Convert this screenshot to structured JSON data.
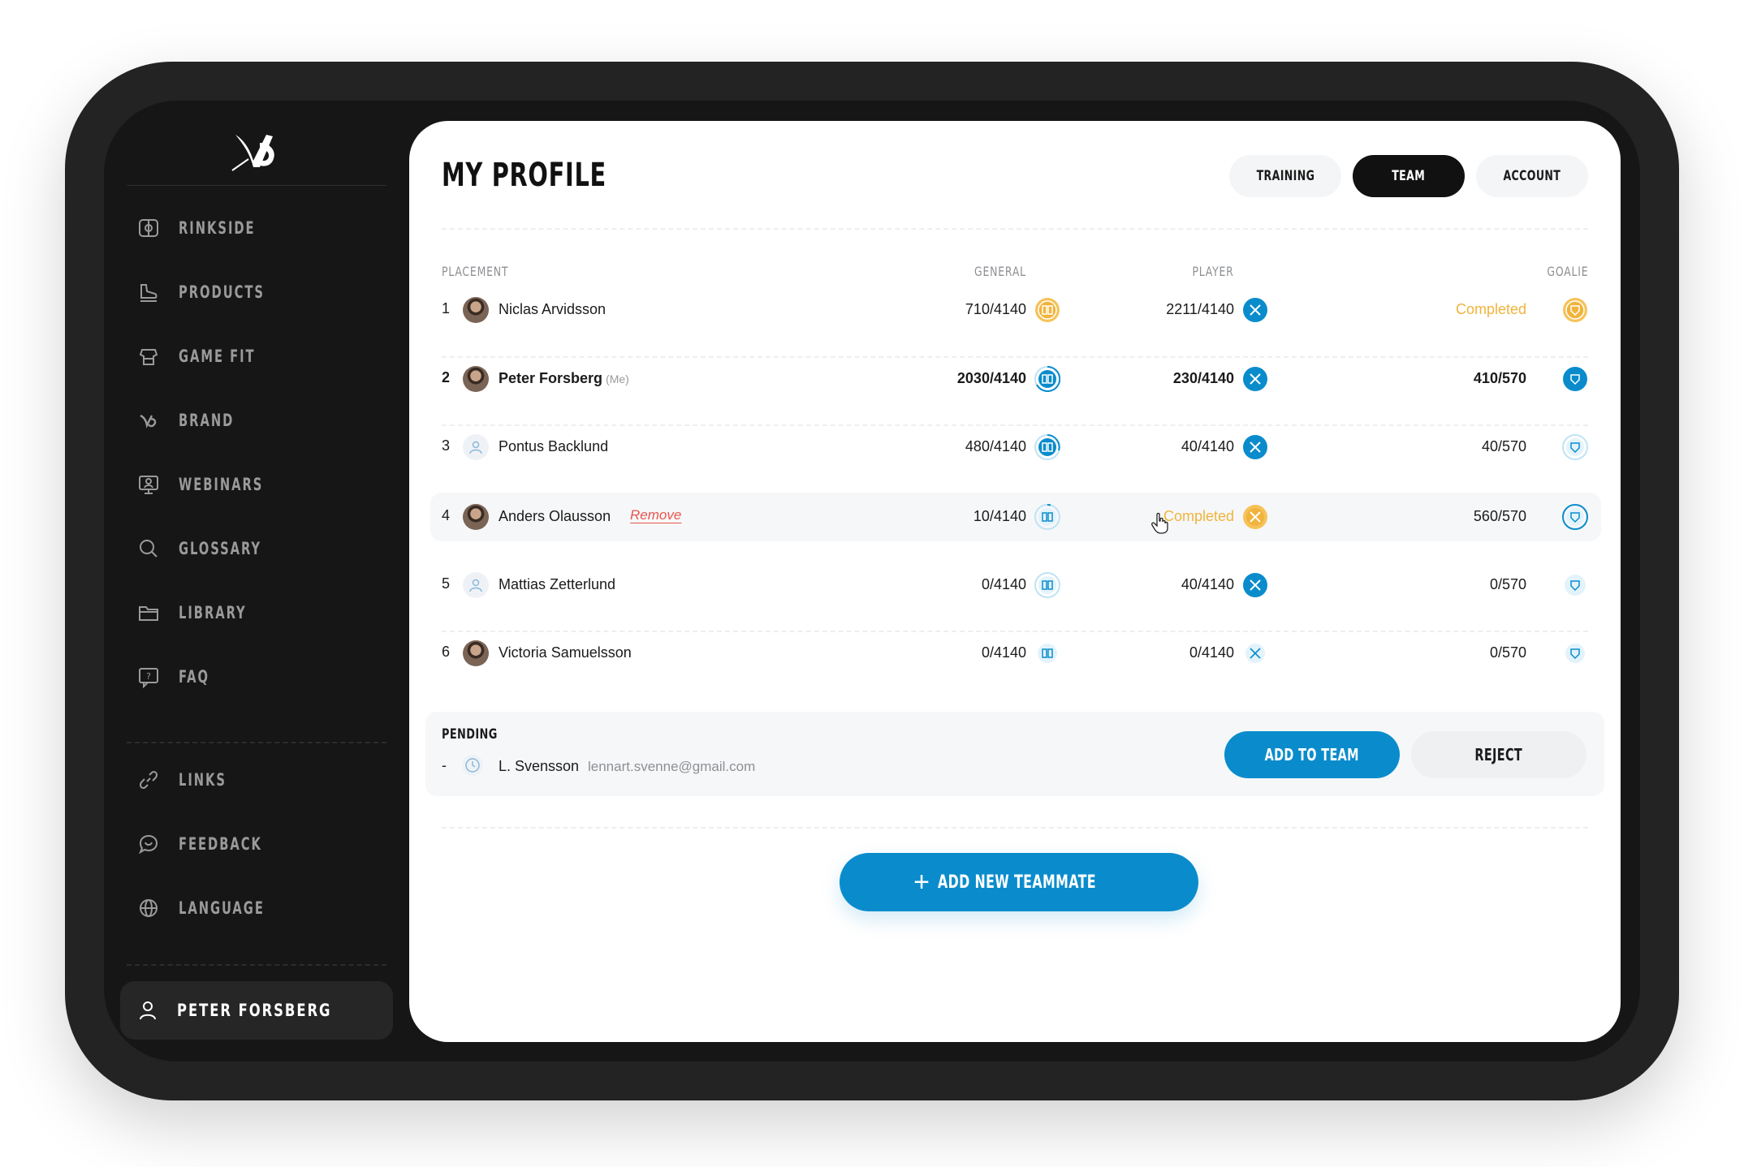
{
  "colors": {
    "accent_blue": "#0a8ccc",
    "gold": "#f0b43c",
    "danger": "#e8564d",
    "sidebar_bg": "#161616"
  },
  "sidebar": {
    "logo_icon": "brand-logo-icon",
    "items": [
      {
        "label": "RINKSIDE",
        "icon": "rink-icon"
      },
      {
        "label": "PRODUCTS",
        "icon": "skate-icon"
      },
      {
        "label": "GAME FIT",
        "icon": "fit-icon"
      },
      {
        "label": "BRAND",
        "icon": "brand-icon"
      },
      {
        "label": "WEBINARS",
        "icon": "webinar-icon"
      },
      {
        "label": "GLOSSARY",
        "icon": "search-icon"
      },
      {
        "label": "LIBRARY",
        "icon": "folder-icon"
      },
      {
        "label": "FAQ",
        "icon": "question-icon"
      }
    ],
    "secondary": [
      {
        "label": "LINKS",
        "icon": "link-icon"
      },
      {
        "label": "FEEDBACK",
        "icon": "chat-icon"
      },
      {
        "label": "LANGUAGE",
        "icon": "globe-icon"
      }
    ],
    "user": "PETER FORSBERG"
  },
  "header": {
    "title": "MY PROFILE",
    "tabs": [
      {
        "label": "TRAINING",
        "active": false
      },
      {
        "label": "TEAM",
        "active": true
      },
      {
        "label": "ACCOUNT",
        "active": false
      }
    ]
  },
  "table": {
    "columns": {
      "placement": "PLACEMENT",
      "general": "GENERAL",
      "player": "PLAYER",
      "goalie": "GOALIE"
    },
    "rows": [
      {
        "rank": "1",
        "name": "Niclas Arvidsson",
        "me": "",
        "general": "710/4140",
        "player": "2211/4140",
        "goalie": "Completed"
      },
      {
        "rank": "2",
        "name": "Peter Forsberg",
        "me": "(Me)",
        "general": "2030/4140",
        "player": "230/4140",
        "goalie": "410/570"
      },
      {
        "rank": "3",
        "name": "Pontus Backlund",
        "me": "",
        "general": "480/4140",
        "player": "40/4140",
        "goalie": "40/570"
      },
      {
        "rank": "4",
        "name": "Anders Olausson",
        "me": "",
        "remove": "Remove",
        "general": "10/4140",
        "player": "Completed",
        "goalie": "560/570"
      },
      {
        "rank": "5",
        "name": "Mattias Zetterlund",
        "me": "",
        "general": "0/4140",
        "player": "40/4140",
        "goalie": "0/570"
      },
      {
        "rank": "6",
        "name": "Victoria Samuelsson",
        "me": "",
        "general": "0/4140",
        "player": "0/4140",
        "goalie": "0/570"
      }
    ]
  },
  "pending": {
    "title": "PENDING",
    "dash": "-",
    "name": "L. Svensson",
    "email": "lennart.svenne@gmail.com",
    "add_label": "ADD TO TEAM",
    "reject_label": "REJECT"
  },
  "add_teammate_label": "ADD NEW TEAMMATE"
}
